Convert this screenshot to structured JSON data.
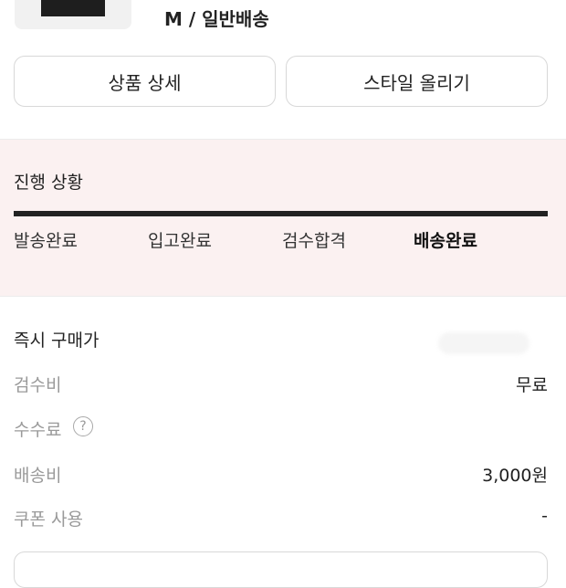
{
  "product": {
    "option": "M / 일반배송"
  },
  "actions": {
    "detail_label": "상품 상세",
    "style_label": "스타일 올리기"
  },
  "progress": {
    "title": "진행 상황",
    "steps": [
      "발송완료",
      "입고완료",
      "검수합격",
      "배송완료"
    ],
    "active_step_index": 3
  },
  "price": {
    "buy_now_label": "즉시 구매가",
    "inspection_label": "검수비",
    "inspection_value": "무료",
    "fee_label": "수수료",
    "fee_help_glyph": "?",
    "shipping_label": "배송비",
    "shipping_value": "3,000원",
    "coupon_label": "쿠폰 사용",
    "coupon_value": "-"
  }
}
